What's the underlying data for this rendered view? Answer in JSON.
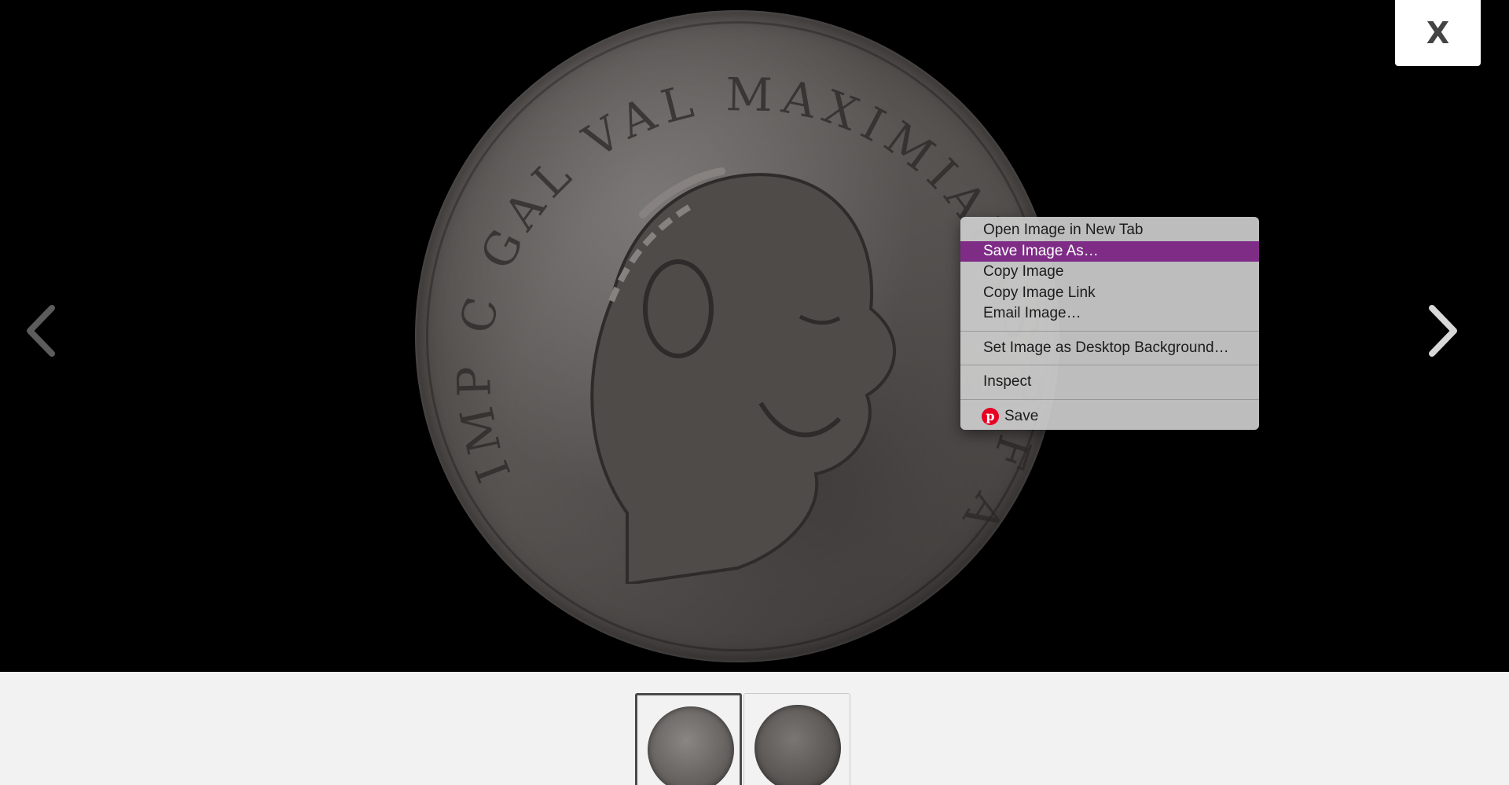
{
  "close_button": {
    "label": "X"
  },
  "navigation": {
    "prev_icon": "chevron-left-icon",
    "next_icon": "chevron-right-icon"
  },
  "image": {
    "description_icon": "coin-obverse-image",
    "legend_text": "IMP C GAL VAL MAXIMIANVS P F AVG"
  },
  "context_menu": {
    "groups": [
      {
        "items": [
          {
            "label": "Open Image in New Tab",
            "active": false
          },
          {
            "label": "Save Image As…",
            "active": true
          },
          {
            "label": "Copy Image",
            "active": false
          },
          {
            "label": "Copy Image Link",
            "active": false
          },
          {
            "label": "Email Image…",
            "active": false
          }
        ]
      },
      {
        "items": [
          {
            "label": "Set Image as Desktop Background…",
            "active": false
          }
        ]
      },
      {
        "items": [
          {
            "label": "Inspect",
            "active": false
          }
        ]
      },
      {
        "items": [
          {
            "label": "Save",
            "active": false,
            "icon": "pinterest-icon"
          }
        ]
      }
    ],
    "highlight_color": "#7e2c86"
  },
  "thumbnails": [
    {
      "name": "coin-obverse-thumbnail",
      "selected": true
    },
    {
      "name": "coin-reverse-thumbnail",
      "selected": false
    }
  ]
}
